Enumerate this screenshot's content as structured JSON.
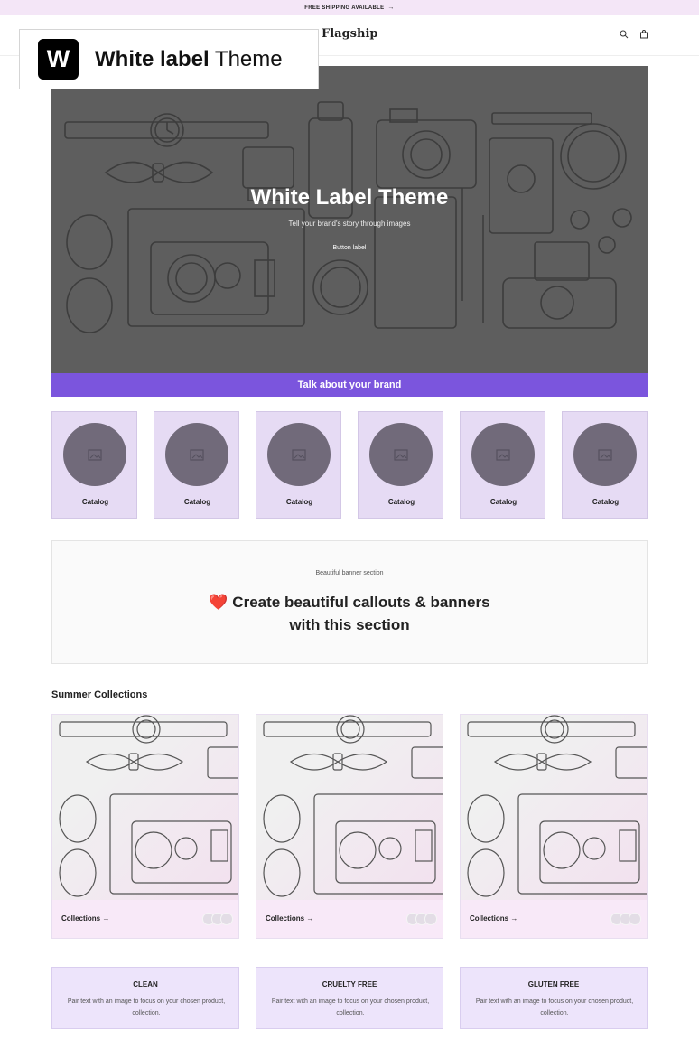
{
  "announcement": {
    "text": "FREE SHIPPING AVAILABLE",
    "arrow": "→"
  },
  "header": {
    "logo": "Flagship",
    "icons": [
      "search-icon",
      "cart-icon"
    ]
  },
  "badge": {
    "letter": "W",
    "bold": "White label",
    "rest": "Theme"
  },
  "hero": {
    "title": "White Label Theme",
    "subtitle": "Tell your brand's story through images",
    "button": "Button label"
  },
  "talk_bar": {
    "text": "Talk about your brand"
  },
  "catalog": [
    {
      "label": "Catalog"
    },
    {
      "label": "Catalog"
    },
    {
      "label": "Catalog"
    },
    {
      "label": "Catalog"
    },
    {
      "label": "Catalog"
    },
    {
      "label": "Catalog"
    }
  ],
  "banner": {
    "eyebrow": "Beautiful banner section",
    "heart": "❤️",
    "line1": "Create beautiful callouts & banners",
    "line2": "with this section"
  },
  "collections": {
    "title": "Summer Collections",
    "items": [
      {
        "label": "Collections →"
      },
      {
        "label": "Collections →"
      },
      {
        "label": "Collections →"
      }
    ]
  },
  "features": [
    {
      "title": "CLEAN",
      "desc": "Pair text with an image to focus on your chosen product, collection."
    },
    {
      "title": "CRUELTY FREE",
      "desc": "Pair text with an image to focus on your chosen product, collection."
    },
    {
      "title": "GLUTEN FREE",
      "desc": "Pair text with an image to focus on your chosen product, collection."
    }
  ],
  "colors": {
    "accent": "#7b55dd",
    "catalog_bg": "#e6dbf4",
    "announce_bg": "#f4e6f7",
    "hero_overlay": "#5e5e5e"
  }
}
